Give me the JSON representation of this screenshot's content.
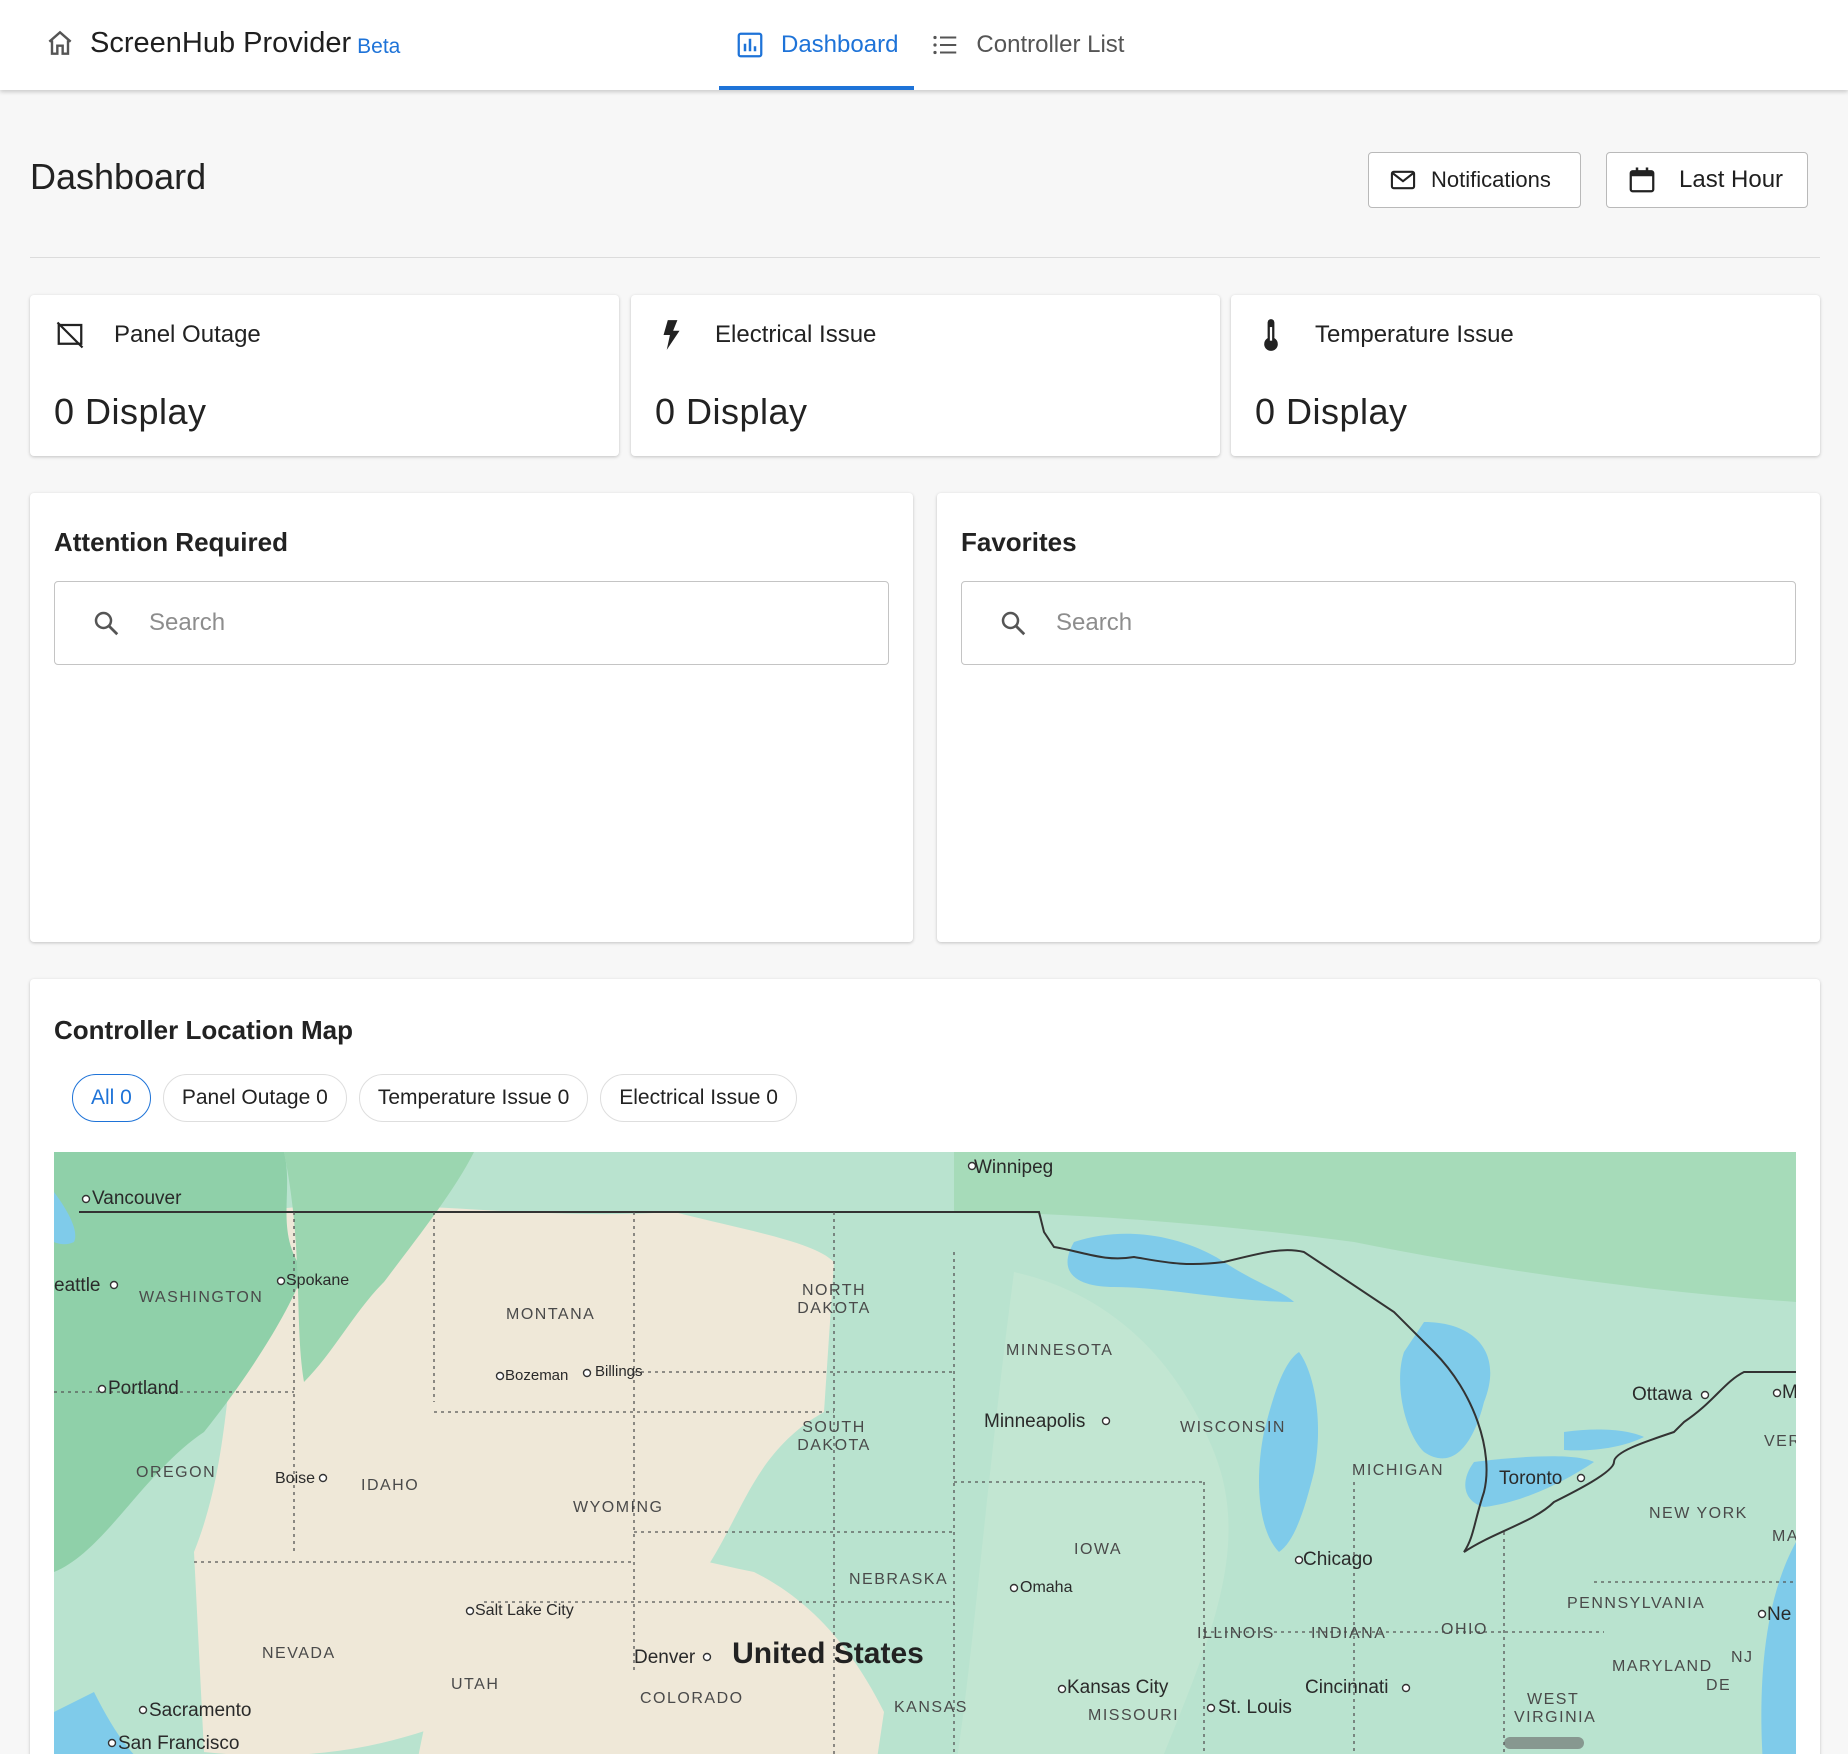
{
  "header": {
    "app_title": "ScreenHub Provider",
    "badge": "Beta",
    "tabs": [
      {
        "label": "Dashboard",
        "icon": "bar-chart-icon",
        "active": true
      },
      {
        "label": "Controller List",
        "icon": "list-icon",
        "active": false
      }
    ]
  },
  "page": {
    "title": "Dashboard",
    "notifications_label": "Notifications",
    "range_label": "Last Hour"
  },
  "stats": [
    {
      "label": "Panel Outage",
      "value": "0 Display",
      "icon": "panel-off-icon"
    },
    {
      "label": "Electrical Issue",
      "value": "0 Display",
      "icon": "lightning-icon"
    },
    {
      "label": "Temperature Issue",
      "value": "0 Display",
      "icon": "thermometer-icon"
    }
  ],
  "attention": {
    "title": "Attention Required",
    "search_placeholder": "Search"
  },
  "favorites": {
    "title": "Favorites",
    "search_placeholder": "Search"
  },
  "map": {
    "title": "Controller Location Map",
    "filters": [
      {
        "label": "All 0",
        "active": true
      },
      {
        "label": "Panel Outage 0",
        "active": false
      },
      {
        "label": "Temperature Issue 0",
        "active": false
      },
      {
        "label": "Electrical Issue 0",
        "active": false
      }
    ],
    "country_label": "United States",
    "cities": [
      "Winnipeg",
      "Vancouver",
      "eattle",
      "Spokane",
      "Portland",
      "Bozeman",
      "Billings",
      "Minneapolis",
      "Ottawa",
      "Toronto",
      "Boise",
      "Chicago",
      "Omaha",
      "Salt Lake City",
      "Denver",
      "Kansas City",
      "Cincinnati",
      "St. Louis",
      "Sacramento",
      "San Francisco"
    ],
    "regions": [
      "WASHINGTON",
      "MONTANA",
      "NORTH DAKOTA",
      "MINNESOTA",
      "SOUTH DAKOTA",
      "WISCONSIN",
      "MICHIGAN",
      "OREGON",
      "IDAHO",
      "WYOMING",
      "NEW YORK",
      "IOWA",
      "NEBRASKA",
      "PENNSYLVANIA",
      "ILLINOIS",
      "INDIANA",
      "OHIO",
      "NEVADA",
      "UTAH",
      "COLORADO",
      "KANSAS",
      "MISSOURI",
      "MARYLAND",
      "WEST VIRGINIA",
      "NJ",
      "DE",
      "VER",
      "MA",
      "Ne",
      "M"
    ],
    "colors": {
      "land": "#b9e3cf",
      "dry": "#efe8d8",
      "forest": "#8fd0a9",
      "water": "#7fcbea",
      "border": "#333333"
    }
  }
}
